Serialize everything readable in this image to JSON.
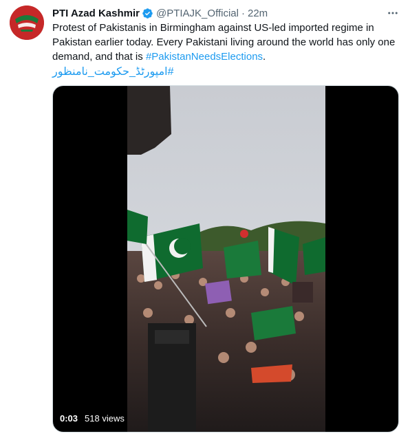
{
  "tweet": {
    "display_name": "PTI Azad Kashmir",
    "handle": "@PTIAJK_Official",
    "separator": "·",
    "time": "22m",
    "verified_icon": "verified-badge-icon",
    "more_icon": "more-options-icon",
    "text_line1": "Protest of Pakistanis in Birmingham against US-led imported regime in",
    "text_line2": "Pakistan earlier today. Every Pakistani living around the world has only one",
    "text_line3_prefix": "demand, and that is ",
    "hashtag1": "#PakistanNeedsElections",
    "text_line3_suffix": ".",
    "hashtag2": "#امپورٹڈ_حکومت_نامنظور"
  },
  "media": {
    "type": "video",
    "current_time": "0:03",
    "views": "518 views"
  },
  "colors": {
    "accent": "#1d9bf0",
    "text": "#0f1419",
    "secondary": "#536471",
    "pakistan_green": "#01411c"
  }
}
